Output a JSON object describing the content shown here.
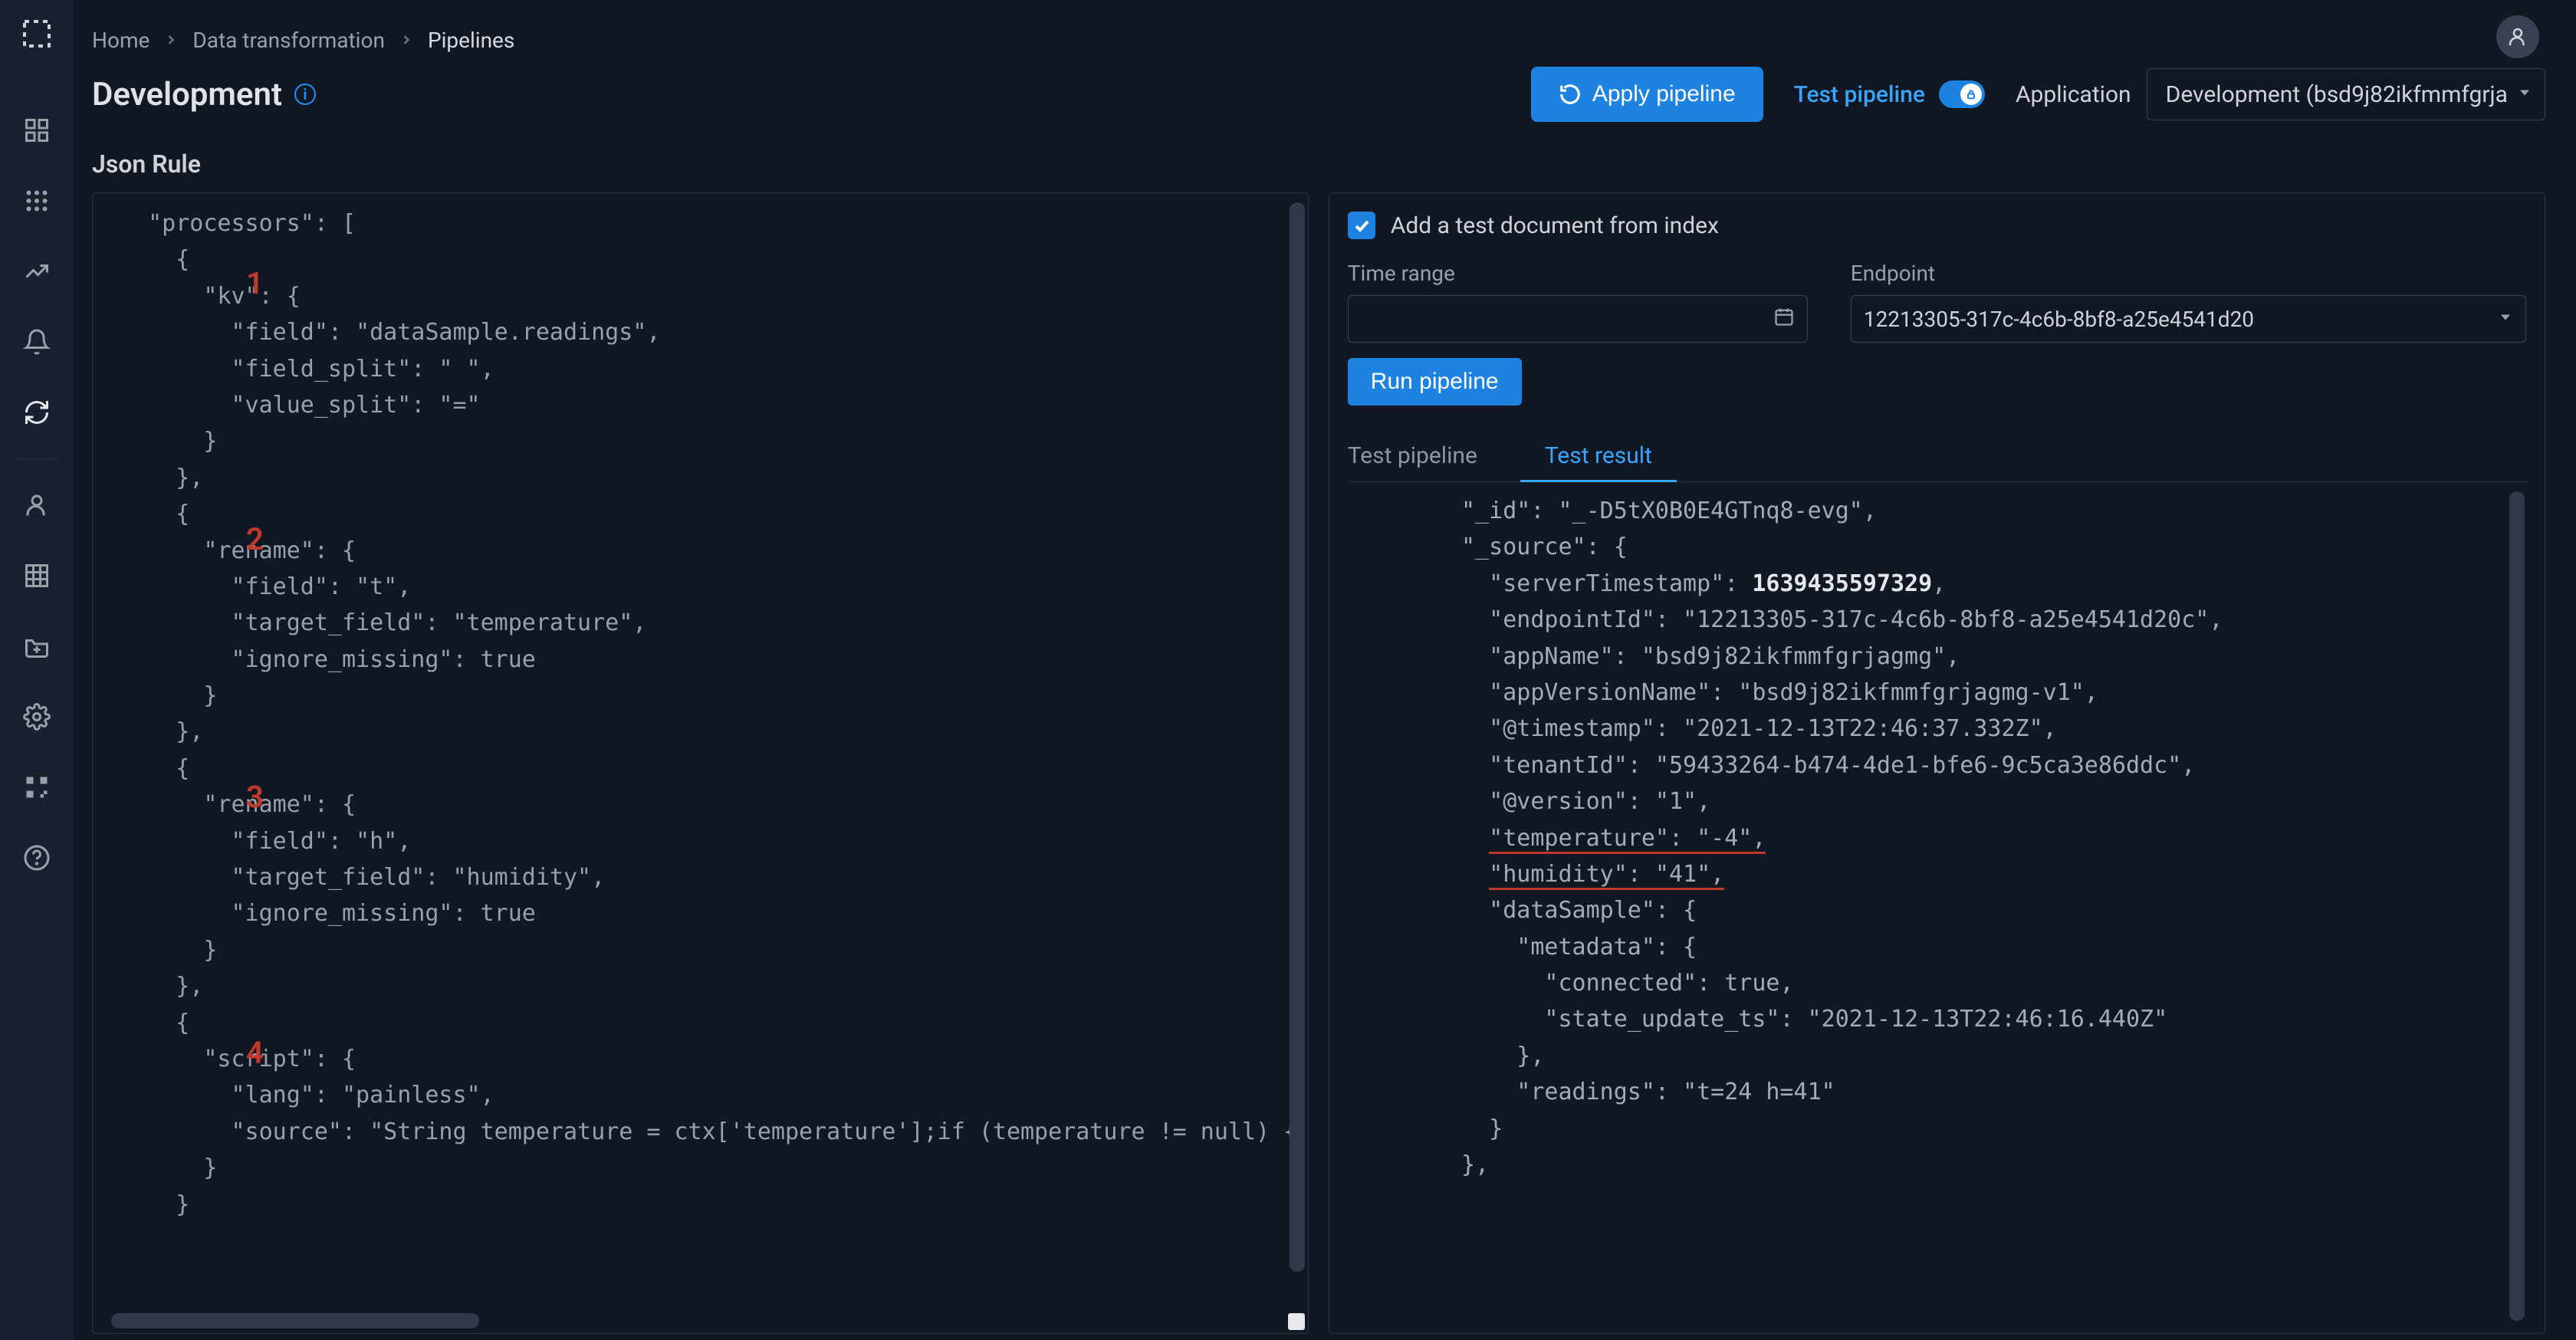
{
  "breadcrumbs": [
    "Home",
    "Data transformation",
    "Pipelines"
  ],
  "page_title": "Development",
  "header": {
    "apply_label": "Apply pipeline",
    "test_link": "Test pipeline",
    "application_label": "Application",
    "application_value": "Development (bsd9j82ikfmmfgrja"
  },
  "section_label": "Json Rule",
  "annotations": [
    "1",
    "2",
    "3",
    "4"
  ],
  "code_text": "  \"processors\": [\n    {\n      \"kv\": {\n        \"field\": \"dataSample.readings\",\n        \"field_split\": \" \",\n        \"value_split\": \"=\"\n      }\n    },\n    {\n      \"rename\": {\n        \"field\": \"t\",\n        \"target_field\": \"temperature\",\n        \"ignore_missing\": true\n      }\n    },\n    {\n      \"rename\": {\n        \"field\": \"h\",\n        \"target_field\": \"humidity\",\n        \"ignore_missing\": true\n      }\n    },\n    {\n      \"script\": {\n        \"lang\": \"painless\",\n        \"source\": \"String temperature = ctx['temperature'];if (temperature != null) { int\n      }\n    }",
  "right": {
    "checkbox_label": "Add a test document from index",
    "checkbox_checked": true,
    "time_range_label": "Time range",
    "time_range_value": "",
    "endpoint_label": "Endpoint",
    "endpoint_value": "12213305-317c-4c6b-8bf8-a25e4541d20",
    "run_label": "Run pipeline",
    "tabs": [
      "Test pipeline",
      "Test result"
    ],
    "active_tab": 1
  },
  "result": {
    "_id": "_-D5tX0B0E4GTnq8-evg",
    "_source": {
      "serverTimestamp": 1639435597329,
      "endpointId": "12213305-317c-4c6b-8bf8-a25e4541d20c",
      "appName": "bsd9j82ikfmmfgrjagmg",
      "appVersionName": "bsd9j82ikfmmfgrjagmg-v1",
      "@timestamp": "2021-12-13T22:46:37.332Z",
      "tenantId": "59433264-b474-4de1-bfe6-9c5ca3e86ddc",
      "@version": "1",
      "temperature": "-4",
      "humidity": "41",
      "dataSample": {
        "metadata": {
          "connected": true,
          "state_update_ts": "2021-12-13T22:46:16.440Z"
        },
        "readings": "t=24 h=41"
      }
    }
  }
}
